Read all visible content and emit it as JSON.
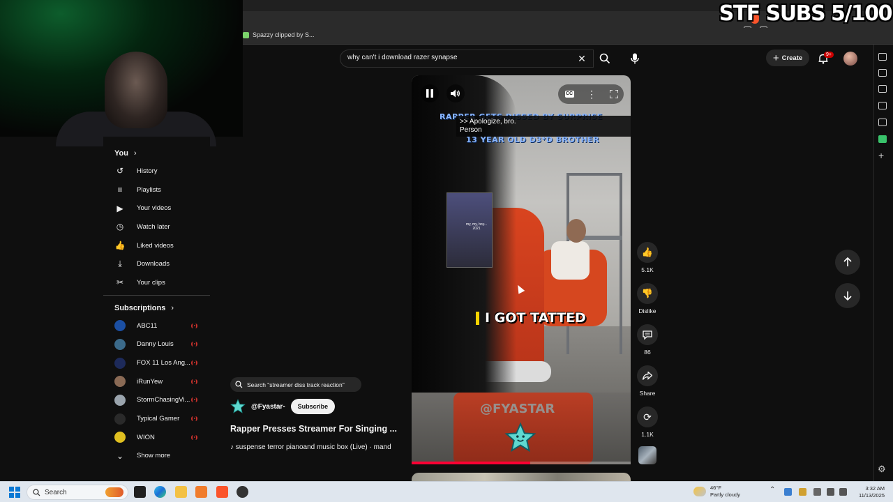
{
  "overlay": {
    "subs_text": "STF SUBS 5/100"
  },
  "bookmarks": [
    {
      "label": "Spazzy clipped by S..."
    }
  ],
  "search": {
    "value": "why can't i download razer synapse"
  },
  "header": {
    "create_label": "Create",
    "notification_count": "9+"
  },
  "sidebar": {
    "you_title": "You",
    "you_items": [
      {
        "label": "History",
        "icon": "history-icon"
      },
      {
        "label": "Playlists",
        "icon": "playlists-icon"
      },
      {
        "label": "Your videos",
        "icon": "your-videos-icon"
      },
      {
        "label": "Watch later",
        "icon": "watch-later-icon"
      },
      {
        "label": "Liked videos",
        "icon": "like-icon"
      },
      {
        "label": "Downloads",
        "icon": "download-icon"
      },
      {
        "label": "Your clips",
        "icon": "scissors-icon"
      }
    ],
    "subscriptions_title": "Subscriptions",
    "subscriptions": [
      {
        "name": "ABC11",
        "color": "#1b4fa3"
      },
      {
        "name": "Danny Louis",
        "color": "#3b6a8a"
      },
      {
        "name": "FOX 11 Los Ang...",
        "color": "#1d2a5a"
      },
      {
        "name": "iRunYew",
        "color": "#8a6a55"
      },
      {
        "name": "StormChasingVi...",
        "color": "#9aa4ad"
      },
      {
        "name": "Typical Gamer",
        "color": "#2a2a2a"
      },
      {
        "name": "WION",
        "color": "#e0c020"
      }
    ],
    "show_more": "Show more"
  },
  "player": {
    "video_title_overlay_1": "RAPPER GETS DISSED BY SURPRISE",
    "captions": [
      ">> Apologize, bro.",
      "Person"
    ],
    "video_title_overlay_2": "13 YEAR OLD D3*D BROTHER",
    "inset_text": "my, my, boy... 2021",
    "on_screen_text": "I GOT TATTED",
    "watermark": "@FYASTAR",
    "progress": 0.54
  },
  "actions": {
    "like_count": "5.1K",
    "dislike_label": "Dislike",
    "comment_count": "86",
    "share_label": "Share",
    "remix_count": "1.1K"
  },
  "meta": {
    "search_suggestion": "Search \"streamer diss track reaction\"",
    "channel": "@Fyastar-",
    "subscribe_label": "Subscribe",
    "title": "Rapper Presses Streamer For Singing ...",
    "music": "suspense terror pianoand music box (Live) · mand"
  },
  "taskbar": {
    "search_placeholder": "Search",
    "weather_temp": "46°F",
    "weather_desc": "Partly cloudy",
    "time": "3:32 AM",
    "date": "11/13/2025"
  }
}
